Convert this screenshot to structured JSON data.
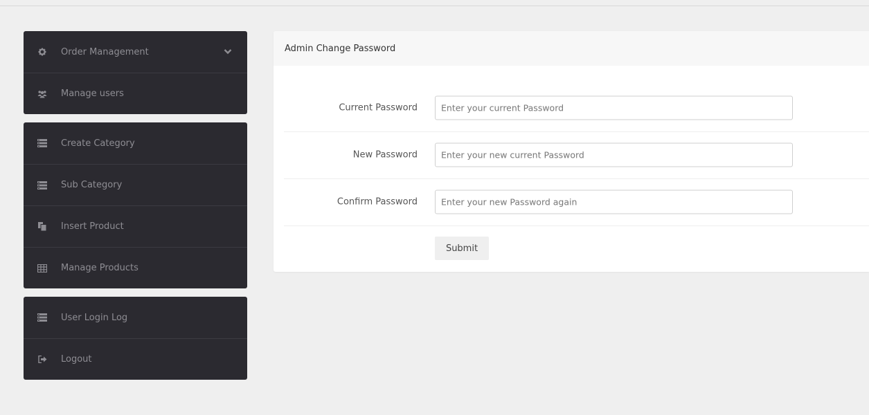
{
  "sidebar": {
    "groups": [
      [
        {
          "label": "Order Management",
          "icon": "gear-icon",
          "has_chevron": true
        },
        {
          "label": "Manage users",
          "icon": "users-icon"
        }
      ],
      [
        {
          "label": "Create Category",
          "icon": "list-icon"
        },
        {
          "label": "Sub Category",
          "icon": "list-icon"
        },
        {
          "label": "Insert Product",
          "icon": "copy-icon"
        },
        {
          "label": "Manage Products",
          "icon": "table-icon"
        }
      ],
      [
        {
          "label": "User Login Log",
          "icon": "list-icon"
        },
        {
          "label": "Logout",
          "icon": "signout-icon"
        }
      ]
    ]
  },
  "panel": {
    "title": "Admin Change Password",
    "fields": [
      {
        "label": "Current Password",
        "placeholder": "Enter your current Password",
        "value": ""
      },
      {
        "label": "New Password",
        "placeholder": "Enter your new current Password",
        "value": ""
      },
      {
        "label": "Confirm Password",
        "placeholder": "Enter your new Password again",
        "value": ""
      }
    ],
    "submit_label": "Submit"
  },
  "colors": {
    "page_bg": "#efefef",
    "sidebar_bg": "#2b2a30",
    "sidebar_text": "#8e8d93",
    "panel_bg": "#ffffff",
    "panel_header_bg": "#f7f7f7"
  }
}
